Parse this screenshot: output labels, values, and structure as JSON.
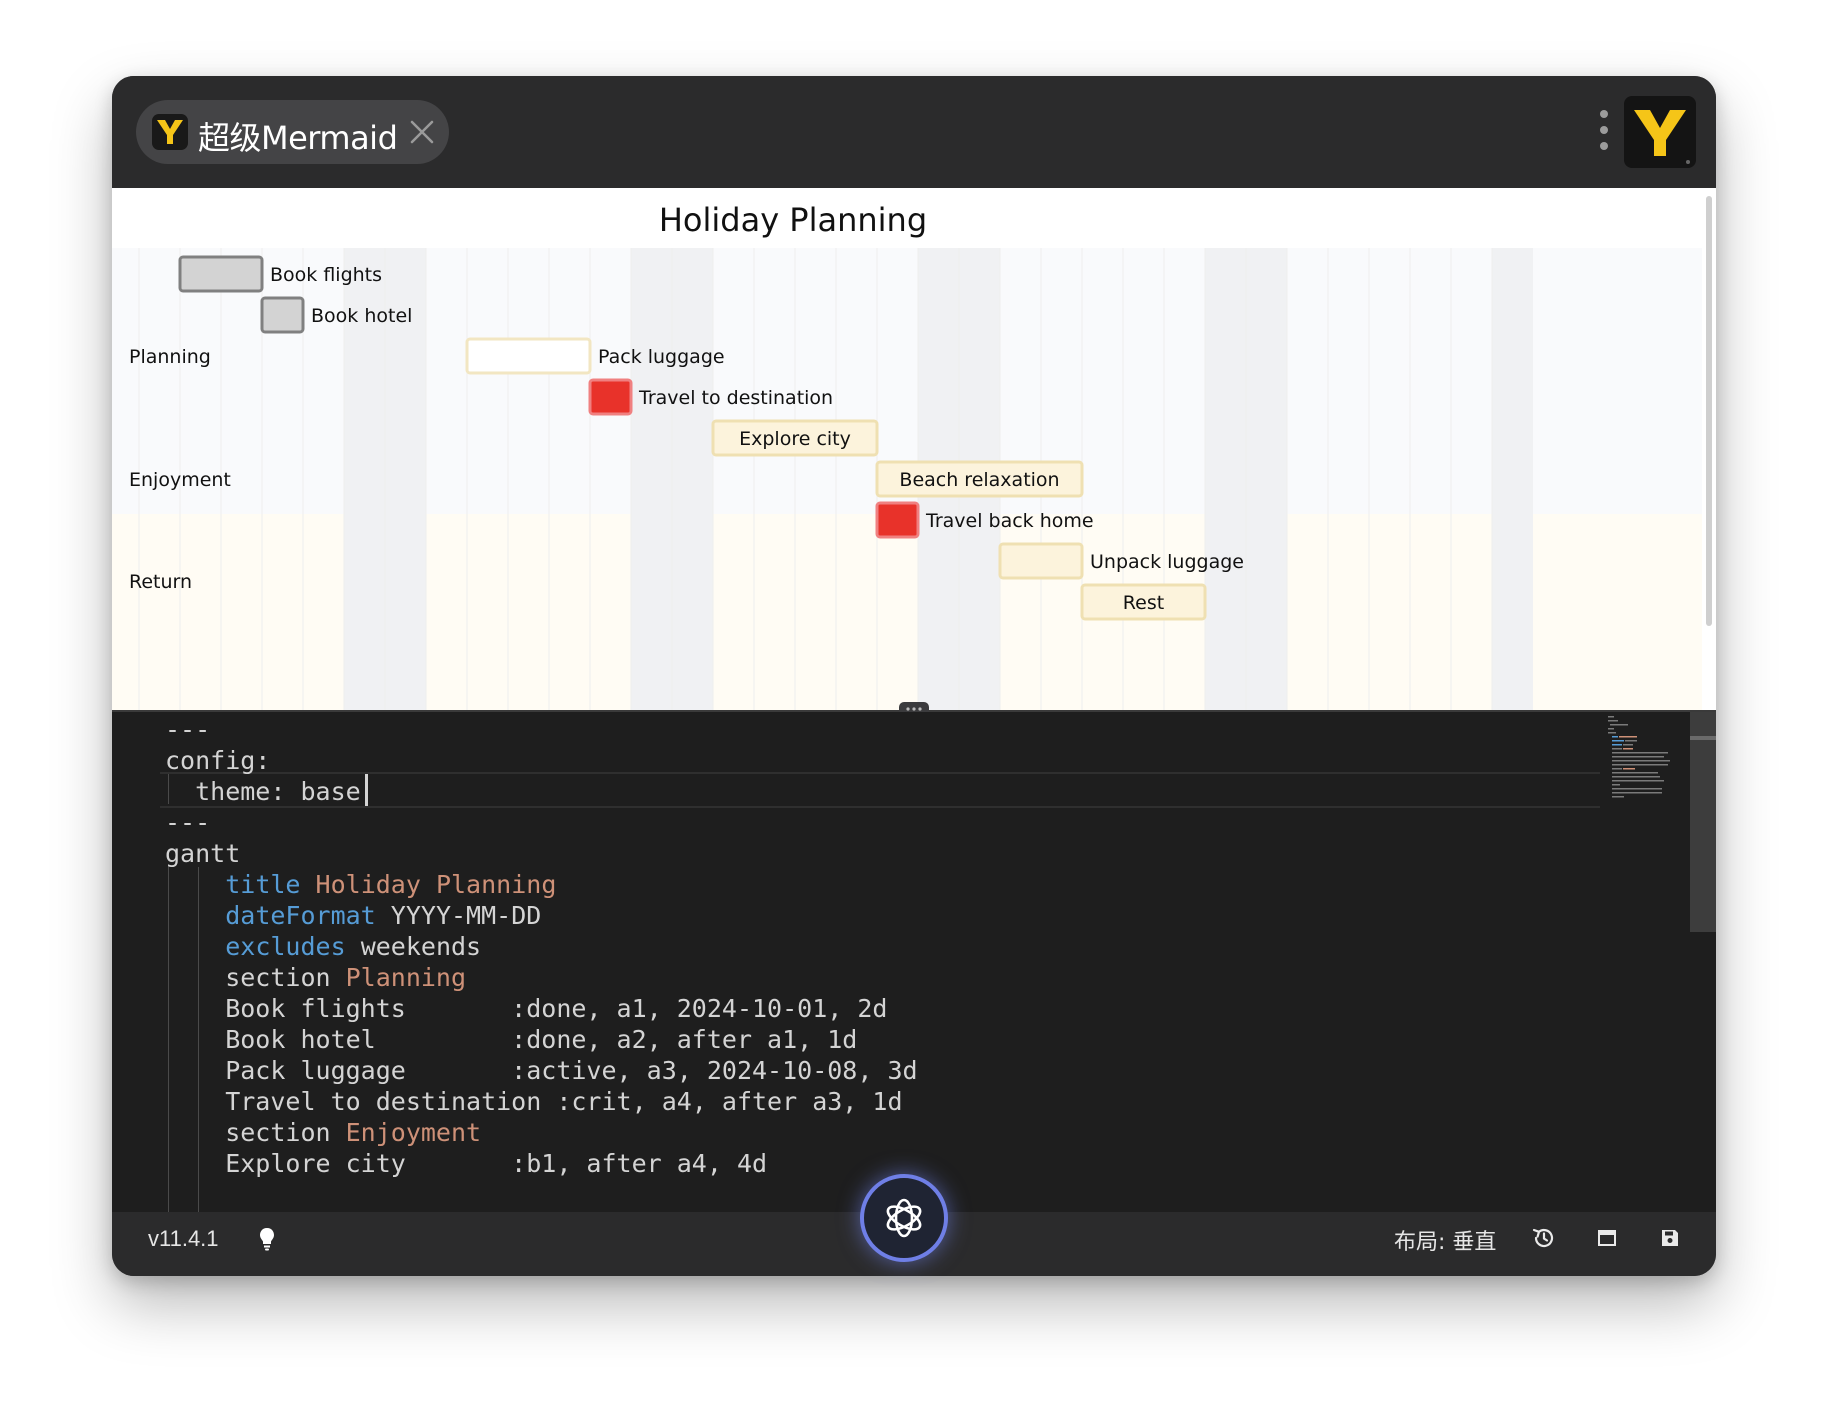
{
  "app": {
    "tab_title": "超级Mermaid",
    "icons": [
      "yellow-y-logo",
      "close-icon",
      "more-vertical-icon"
    ]
  },
  "gantt": {
    "title": "Holiday Planning",
    "sections": [
      {
        "label": "Planning"
      },
      {
        "label": "Enjoyment"
      },
      {
        "label": "Return"
      }
    ],
    "tasks": [
      {
        "label": "Book flights",
        "status": "done",
        "start": "2024-10-01",
        "end": "2024-10-03"
      },
      {
        "label": "Book hotel",
        "status": "done",
        "start": "2024-10-03",
        "end": "2024-10-04"
      },
      {
        "label": "Pack luggage",
        "status": "active",
        "start": "2024-10-08",
        "end": "2024-10-11"
      },
      {
        "label": "Travel to destination",
        "status": "crit",
        "start": "2024-10-11",
        "end": "2024-10-12"
      },
      {
        "label": "Explore city",
        "status": "normal",
        "start": "2024-10-14",
        "end": "2024-10-18"
      },
      {
        "label": "Beach relaxation",
        "status": "normal",
        "start": "2024-10-18",
        "end": "2024-10-23"
      },
      {
        "label": "Travel back home",
        "status": "crit",
        "start": "2024-10-18",
        "end": "2024-10-19"
      },
      {
        "label": "Unpack luggage",
        "status": "normal",
        "start": "2024-10-21",
        "end": "2024-10-23"
      },
      {
        "label": "Rest",
        "status": "normal",
        "start": "2024-10-23",
        "end": "2024-10-26"
      }
    ],
    "colors": {
      "done_fill": "#d3d3d3",
      "done_border": "#808080",
      "active_fill": "#ffffff",
      "active_border": "#f2e6c2",
      "crit_fill": "#e8322a",
      "crit_border": "#f08080",
      "normal_fill": "#fcf3dc",
      "normal_border": "#efe0b2",
      "weekend_band": "#f0f1f3"
    }
  },
  "editor": {
    "lines": [
      [
        {
          "t": "---"
        }
      ],
      [
        {
          "t": "config:"
        }
      ],
      [
        {
          "t": "  theme: base "
        }
      ],
      [
        {
          "t": "---"
        }
      ],
      [
        {
          "t": "gantt"
        }
      ],
      [
        {
          "t": "    "
        },
        {
          "t": "title",
          "c": "kw"
        },
        {
          "t": " "
        },
        {
          "t": "Holiday Planning",
          "c": "str"
        }
      ],
      [
        {
          "t": "    "
        },
        {
          "t": "dateFormat",
          "c": "kw"
        },
        {
          "t": " YYYY-MM-DD"
        }
      ],
      [
        {
          "t": "    "
        },
        {
          "t": "excludes",
          "c": "kw"
        },
        {
          "t": " weekends"
        }
      ],
      [
        {
          "t": "    section "
        },
        {
          "t": "Planning",
          "c": "str"
        }
      ],
      [
        {
          "t": "    Book flights       :done, a1, 2024-10-01, 2d"
        }
      ],
      [
        {
          "t": "    Book hotel         :done, a2, after a1, 1d"
        }
      ],
      [
        {
          "t": "    Pack luggage       :active, a3, 2024-10-08, 3d"
        }
      ],
      [
        {
          "t": "    Travel to destination :crit, a4, after a3, 1d"
        }
      ],
      [
        {
          "t": "    section "
        },
        {
          "t": "Enjoyment",
          "c": "str"
        }
      ],
      [
        {
          "t": "    Explore city       :b1, after a4, 4d"
        }
      ]
    ]
  },
  "statusbar": {
    "version": "v11.4.1",
    "layout_label": "布局: 垂直",
    "icons": [
      "lightbulb-icon",
      "history-icon",
      "window-icon",
      "save-icon"
    ]
  }
}
